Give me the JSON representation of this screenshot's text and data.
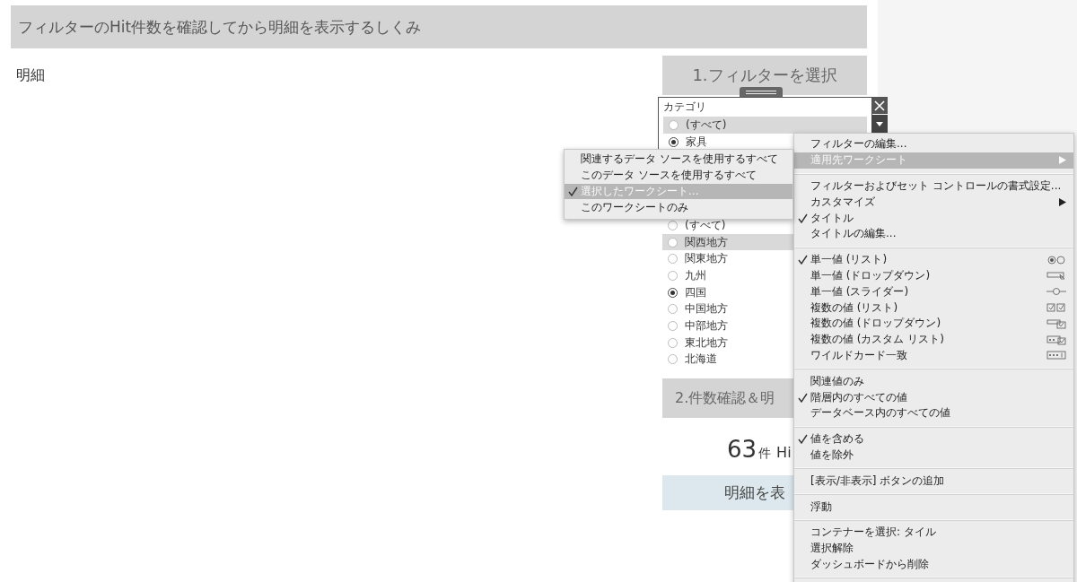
{
  "header": {
    "title": "フィルターのHit件数を確認してから明細を表示するしくみ"
  },
  "detail_label": "明細",
  "step1": {
    "title": "1.フィルターを選択"
  },
  "category_filter": {
    "title": "カテゴリ",
    "options": [
      {
        "label": "(すべて)",
        "selected": false,
        "highlighted": true
      },
      {
        "label": "家具",
        "selected": true,
        "highlighted": false
      }
    ]
  },
  "region_filter": {
    "options": [
      {
        "label": "(すべて)",
        "selected": false,
        "highlighted": false
      },
      {
        "label": "関西地方",
        "selected": false,
        "highlighted": true
      },
      {
        "label": "関東地方",
        "selected": false,
        "highlighted": false
      },
      {
        "label": "九州",
        "selected": false,
        "highlighted": false
      },
      {
        "label": "四国",
        "selected": true,
        "highlighted": false
      },
      {
        "label": "中国地方",
        "selected": false,
        "highlighted": false
      },
      {
        "label": "中部地方",
        "selected": false,
        "highlighted": false
      },
      {
        "label": "東北地方",
        "selected": false,
        "highlighted": false
      },
      {
        "label": "北海道",
        "selected": false,
        "highlighted": false
      }
    ]
  },
  "step2": {
    "title": "2.件数確認＆明"
  },
  "hit_count": {
    "number": "63",
    "unit": "件",
    "suffix": "Hi"
  },
  "show_button": {
    "label": "明細を表"
  },
  "context_menu": {
    "sections": [
      [
        {
          "label": "フィルターの編集...",
          "kind": "plain",
          "checked": false,
          "highlighted": false
        },
        {
          "label": "適用先ワークシート",
          "kind": "submenu",
          "checked": false,
          "highlighted": true
        }
      ],
      [
        {
          "label": "フィルターおよびセット コントロールの書式設定...",
          "kind": "plain",
          "checked": false,
          "highlighted": false
        },
        {
          "label": "カスタマイズ",
          "kind": "submenu",
          "checked": false,
          "highlighted": false
        },
        {
          "label": "タイトル",
          "kind": "plain",
          "checked": true,
          "highlighted": false
        },
        {
          "label": "タイトルの編集...",
          "kind": "plain",
          "checked": false,
          "highlighted": false
        }
      ],
      [
        {
          "label": "単一値 (リスト)",
          "kind": "radios",
          "checked": true,
          "highlighted": false
        },
        {
          "label": "単一値 (ドロップダウン)",
          "kind": "dropdown",
          "checked": false,
          "highlighted": false
        },
        {
          "label": "単一値 (スライダー)",
          "kind": "slider",
          "checked": false,
          "highlighted": false
        },
        {
          "label": "複数の値 (リスト)",
          "kind": "checkboxes",
          "checked": false,
          "highlighted": false
        },
        {
          "label": "複数の値 (ドロップダウン)",
          "kind": "checkdropdown",
          "checked": false,
          "highlighted": false
        },
        {
          "label": "複数の値 (カスタム リスト)",
          "kind": "customlist",
          "checked": false,
          "highlighted": false
        },
        {
          "label": "ワイルドカード一致",
          "kind": "wildcard",
          "checked": false,
          "highlighted": false
        }
      ],
      [
        {
          "label": "関連値のみ",
          "kind": "plain",
          "checked": false,
          "highlighted": false
        },
        {
          "label": "階層内のすべての値",
          "kind": "plain",
          "checked": true,
          "highlighted": false
        },
        {
          "label": "データベース内のすべての値",
          "kind": "plain",
          "checked": false,
          "highlighted": false
        }
      ],
      [
        {
          "label": "値を含める",
          "kind": "plain",
          "checked": true,
          "highlighted": false
        },
        {
          "label": "値を除外",
          "kind": "plain",
          "checked": false,
          "highlighted": false
        }
      ],
      [
        {
          "label": "[表示/非表示] ボタンの追加",
          "kind": "plain",
          "checked": false,
          "highlighted": false
        }
      ],
      [
        {
          "label": "浮動",
          "kind": "plain",
          "checked": false,
          "highlighted": false
        }
      ],
      [
        {
          "label": "コンテナーを選択: タイル",
          "kind": "plain",
          "checked": false,
          "highlighted": false
        },
        {
          "label": "選択解除",
          "kind": "plain",
          "checked": false,
          "highlighted": false
        },
        {
          "label": "ダッシュボードから削除",
          "kind": "plain",
          "checked": false,
          "highlighted": false
        }
      ]
    ]
  },
  "submenu": {
    "items": [
      {
        "label": "関連するデータ ソースを使用するすべて",
        "checked": false,
        "highlighted": false
      },
      {
        "label": "このデータ ソースを使用するすべて",
        "checked": false,
        "highlighted": false
      },
      {
        "label": "選択したワークシート...",
        "checked": true,
        "highlighted": true
      },
      {
        "label": "このワークシートのみ",
        "checked": false,
        "highlighted": false
      }
    ]
  }
}
